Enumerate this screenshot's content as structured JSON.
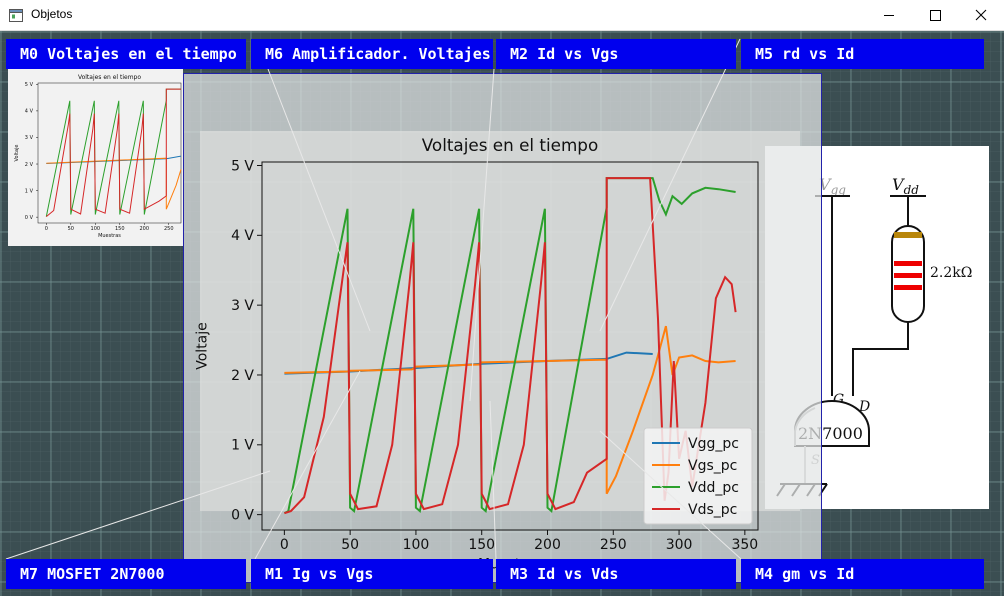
{
  "window": {
    "title": "Objetos",
    "controls": {
      "minimize_icon": "minimize-icon",
      "maximize_icon": "maximize-icon",
      "close_icon": "close-icon"
    }
  },
  "tabs": {
    "m0": "M0  Voltajes en el tiempo",
    "m6": "M6  Amplificador. Voltajes",
    "m2": "M2  Id vs Vgs",
    "m5": "M5  rd vs Id",
    "m7": "M7  MOSFET 2N7000",
    "m1": "M1  Ig vs Vgs",
    "m3": "M3  Id vs Vds",
    "m4": "M4  gm vs Id"
  },
  "colors": {
    "tab_bg": "#0000ee",
    "vgg": "#1f77b4",
    "vgs": "#ff7f0e",
    "vdd": "#2ca02c",
    "vds": "#d62728"
  },
  "schematic": {
    "vgg": "V",
    "vgg_sub": "gg",
    "vdd": "V",
    "vdd_sub": "dd",
    "resistor": "2.2kΩ",
    "gate": "G",
    "drain": "D",
    "source": "S",
    "part": "2N7000"
  },
  "chart_data": [
    {
      "type": "line",
      "title": "Voltajes en el tiempo",
      "xlabel": "Muestras",
      "ylabel": "Voltaje",
      "xlim": [
        -17,
        360
      ],
      "ylim": [
        -0.22,
        5.05
      ],
      "xticks": [
        0,
        50,
        100,
        150,
        200,
        250,
        300,
        350
      ],
      "yticks": [
        0,
        1,
        2,
        3,
        4,
        5
      ],
      "ytick_labels": [
        "0 V",
        "1 V",
        "2 V",
        "3 V",
        "4 V",
        "5 V"
      ],
      "legend": "lower-right",
      "grid": false,
      "series": [
        {
          "name": "Vgg_pc",
          "color": "#1f77b4",
          "points": [
            [
              0,
              2.02
            ],
            [
              50,
              2.05
            ],
            [
              100,
              2.1
            ],
            [
              150,
              2.16
            ],
            [
              200,
              2.2
            ],
            [
              245,
              2.23
            ],
            [
              260,
              2.32
            ],
            [
              280,
              2.3
            ]
          ]
        },
        {
          "name": "Vgs_pc",
          "color": "#ff7f0e",
          "points": [
            [
              0,
              2.03
            ],
            [
              48,
              2.05
            ],
            [
              50,
              2.06
            ],
            [
              97,
              2.08
            ],
            [
              100,
              2.12
            ],
            [
              148,
              2.15
            ],
            [
              150,
              2.18
            ],
            [
              198,
              2.2
            ],
            [
              200,
              2.2
            ],
            [
              245,
              2.22
            ],
            [
              245,
              0.3
            ],
            [
              252,
              0.55
            ],
            [
              265,
              1.2
            ],
            [
              280,
              2.0
            ],
            [
              290,
              2.7
            ],
            [
              295,
              2.0
            ],
            [
              300,
              2.25
            ],
            [
              310,
              2.28
            ],
            [
              320,
              2.2
            ],
            [
              330,
              2.18
            ],
            [
              343,
              2.2
            ]
          ]
        },
        {
          "name": "Vdd_pc",
          "color": "#2ca02c",
          "points": [
            [
              0,
              0.02
            ],
            [
              3,
              0.05
            ],
            [
              48,
              4.38
            ],
            [
              50,
              0.1
            ],
            [
              53,
              0.05
            ],
            [
              98,
              4.38
            ],
            [
              100,
              0.1
            ],
            [
              103,
              0.05
            ],
            [
              148,
              4.38
            ],
            [
              150,
              0.1
            ],
            [
              153,
              0.05
            ],
            [
              198,
              4.38
            ],
            [
              200,
              0.1
            ],
            [
              203,
              0.05
            ],
            [
              245,
              4.4
            ],
            [
              245,
              4.82
            ],
            [
              280,
              4.82
            ],
            [
              285,
              4.5
            ],
            [
              290,
              4.3
            ],
            [
              295,
              4.56
            ],
            [
              302,
              4.45
            ],
            [
              310,
              4.6
            ],
            [
              320,
              4.68
            ],
            [
              330,
              4.66
            ],
            [
              343,
              4.62
            ]
          ]
        },
        {
          "name": "Vds_pc",
          "color": "#d62728",
          "points": [
            [
              0,
              0.02
            ],
            [
              5,
              0.05
            ],
            [
              15,
              0.25
            ],
            [
              30,
              1.4
            ],
            [
              45,
              3.5
            ],
            [
              48,
              3.9
            ],
            [
              50,
              0.3
            ],
            [
              56,
              0.08
            ],
            [
              70,
              0.12
            ],
            [
              82,
              1.0
            ],
            [
              95,
              3.3
            ],
            [
              98,
              3.9
            ],
            [
              100,
              0.3
            ],
            [
              106,
              0.08
            ],
            [
              120,
              0.15
            ],
            [
              132,
              1.0
            ],
            [
              145,
              3.3
            ],
            [
              148,
              3.9
            ],
            [
              150,
              0.3
            ],
            [
              156,
              0.08
            ],
            [
              170,
              0.15
            ],
            [
              182,
              1.0
            ],
            [
              195,
              3.3
            ],
            [
              198,
              3.9
            ],
            [
              200,
              0.3
            ],
            [
              206,
              0.08
            ],
            [
              220,
              0.18
            ],
            [
              230,
              0.6
            ],
            [
              245,
              0.8
            ],
            [
              245,
              4.82
            ],
            [
              278,
              4.82
            ],
            [
              284,
              2.8
            ],
            [
              289,
              0.2
            ],
            [
              292,
              0.6
            ],
            [
              296,
              2.2
            ],
            [
              300,
              0.8
            ],
            [
              305,
              1.2
            ],
            [
              310,
              0.4
            ],
            [
              320,
              1.6
            ],
            [
              328,
              3.1
            ],
            [
              335,
              3.4
            ],
            [
              340,
              3.3
            ],
            [
              343,
              2.9
            ]
          ]
        }
      ]
    },
    {
      "type": "line",
      "title": "Voltajes en el tiempo",
      "xlabel": "Muestras",
      "ylabel": "Voltaje",
      "xlim": [
        -17,
        275
      ],
      "ylim": [
        -0.22,
        5.05
      ],
      "xticks": [
        0,
        50,
        100,
        150,
        200,
        250
      ],
      "yticks": [
        0,
        1,
        2,
        3,
        4,
        5
      ],
      "ytick_labels": [
        "0 V",
        "1 V",
        "2 V",
        "3 V",
        "4 V",
        "5 V"
      ],
      "series": [
        {
          "name": "Vgg_pc",
          "color": "#1f77b4",
          "points": [
            [
              0,
              2.02
            ],
            [
              245,
              2.2
            ],
            [
              275,
              2.3
            ]
          ]
        },
        {
          "name": "Vgs_pc",
          "color": "#ff7f0e",
          "points": [
            [
              0,
              2.03
            ],
            [
              245,
              2.22
            ],
            [
              245,
              0.3
            ],
            [
              265,
              1.2
            ],
            [
              275,
              1.8
            ]
          ]
        },
        {
          "name": "Vdd_pc",
          "color": "#2ca02c",
          "points": [
            [
              0,
              0.02
            ],
            [
              48,
              4.38
            ],
            [
              50,
              0.1
            ],
            [
              98,
              4.38
            ],
            [
              100,
              0.1
            ],
            [
              148,
              4.38
            ],
            [
              150,
              0.1
            ],
            [
              198,
              4.38
            ],
            [
              200,
              0.1
            ],
            [
              245,
              4.4
            ],
            [
              245,
              4.82
            ],
            [
              275,
              4.82
            ]
          ]
        },
        {
          "name": "Vds_pc",
          "color": "#d62728",
          "points": [
            [
              0,
              0.02
            ],
            [
              15,
              0.25
            ],
            [
              45,
              3.5
            ],
            [
              48,
              3.9
            ],
            [
              50,
              0.3
            ],
            [
              70,
              0.12
            ],
            [
              95,
              3.3
            ],
            [
              98,
              3.9
            ],
            [
              100,
              0.3
            ],
            [
              120,
              0.15
            ],
            [
              145,
              3.3
            ],
            [
              148,
              3.9
            ],
            [
              150,
              0.3
            ],
            [
              170,
              0.15
            ],
            [
              195,
              3.3
            ],
            [
              198,
              3.9
            ],
            [
              200,
              0.3
            ],
            [
              230,
              0.6
            ],
            [
              245,
              0.8
            ],
            [
              245,
              4.82
            ],
            [
              275,
              4.82
            ]
          ]
        }
      ]
    }
  ]
}
